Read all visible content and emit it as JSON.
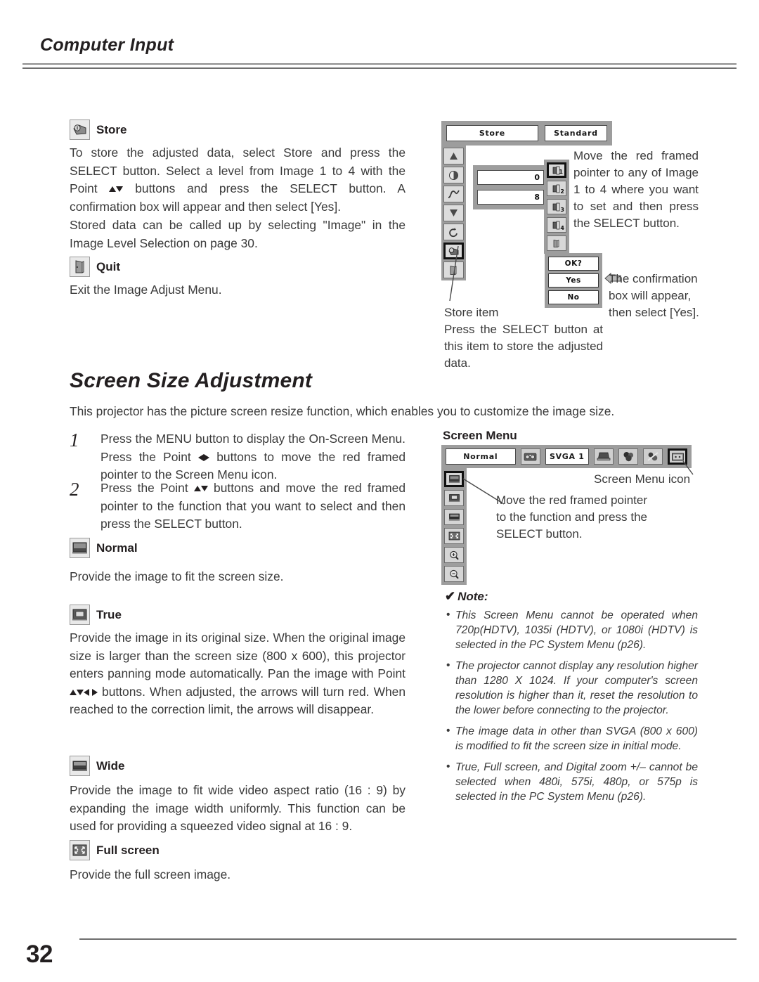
{
  "header": {
    "title": "Computer Input"
  },
  "sections": {
    "store": {
      "heading": "Store",
      "icon": "store-icon",
      "body_1": "To store the adjusted data, select Store and press the SELECT button.  Select a level from Image 1 to 4 with the Point ",
      "body_2": " buttons and press the SELECT button.  A confirmation box will appear and then select [Yes].",
      "body_3": "Stored data can be called up by selecting \"Image\" in the Image Level Selection on page 30."
    },
    "quit": {
      "heading": "Quit",
      "icon": "quit-door-icon",
      "body": "Exit the Image Adjust Menu."
    },
    "normal": {
      "heading": "Normal",
      "icon": "screen-normal-icon",
      "body": "Provide the image to fit the screen size."
    },
    "true": {
      "heading": "True",
      "icon": "screen-true-icon",
      "body_1": "Provide the image in its original size.  When the original image size is larger than the screen size (800 x 600), this projector enters panning mode automatically.  Pan the image with Point ",
      "body_2": " buttons.  When adjusted, the arrows will turn red.  When reached to the correction limit, the arrows will disappear."
    },
    "wide": {
      "heading": "Wide",
      "icon": "screen-wide-icon",
      "body": "Provide the image to fit wide video aspect ratio (16 : 9) by expanding the image width uniformly.  This function can be used for providing a squeezed video signal at 16 : 9."
    },
    "full_screen": {
      "heading": "Full screen",
      "icon": "screen-full-icon",
      "body": "Provide the full screen image."
    }
  },
  "screen_size_adjustment": {
    "title": "Screen Size Adjustment",
    "intro": "This projector has the picture screen resize function, which enables you to customize the image size.",
    "steps": [
      {
        "number": "1",
        "text_1": "Press the MENU button to display the On-Screen Menu.  Press the Point ",
        "text_2": " buttons to move the red framed pointer to the Screen Menu icon."
      },
      {
        "number": "2",
        "text_1": "Press the Point ",
        "text_2": " buttons and move the red framed pointer to the function that you want to select and then press the SELECT button."
      }
    ]
  },
  "image_adjust_osd": {
    "tabs": [
      {
        "label": "Store",
        "name": "store-tab"
      },
      {
        "label": "Standard",
        "name": "standard-tab"
      }
    ],
    "values": [
      {
        "value": "0",
        "name": "contrast-value"
      },
      {
        "value": "8",
        "name": "brightness-value"
      }
    ],
    "left_icons": [
      {
        "name": "contrast-icon"
      },
      {
        "name": "brightness-icon"
      },
      {
        "name": "gamma-icon"
      },
      {
        "name": "color-temp-icon"
      },
      {
        "name": "reset-icon"
      },
      {
        "name": "store-icon"
      },
      {
        "name": "quit-door-icon"
      }
    ],
    "image_levels": [
      {
        "label": "1",
        "name": "image-level-1"
      },
      {
        "label": "2",
        "name": "image-level-2"
      },
      {
        "label": "3",
        "name": "image-level-3"
      },
      {
        "label": "4",
        "name": "image-level-4"
      }
    ],
    "image_quit": {
      "name": "quit-door-icon"
    },
    "confirm_box": {
      "prompt": "OK?",
      "yes": "Yes",
      "no": "No"
    }
  },
  "callouts": {
    "move_pointer_image": "Move the red framed pointer to any of Image 1 to 4 where you want to set and then press the SELECT button.",
    "confirmation": "The confirmation box will appear, then select [Yes].",
    "store_item_title": "Store item",
    "store_item_body": "Press the SELECT button at this item to store the adjusted data.",
    "screen_menu_icon": "Screen Menu icon",
    "move_pointer_function": "Move the red framed pointer to the function and press the SELECT button."
  },
  "screen_menu": {
    "label": "Screen Menu",
    "current_mode": "Normal",
    "system": "SVGA 1",
    "top_icons": [
      {
        "name": "pc-system-icon"
      },
      {
        "name": "computer-input-icon"
      },
      {
        "name": "color-adjust-icon"
      },
      {
        "name": "image-adjust-icon"
      },
      {
        "name": "screen-menu-icon"
      }
    ],
    "left_items": [
      {
        "name": "screen-normal-icon"
      },
      {
        "name": "screen-true-icon"
      },
      {
        "name": "screen-wide-icon"
      },
      {
        "name": "screen-full-icon"
      },
      {
        "name": "digital-zoom-in-icon"
      },
      {
        "name": "digital-zoom-out-icon"
      }
    ]
  },
  "note": {
    "title": "Note:",
    "items": [
      "This Screen Menu cannot be operated when 720p(HDTV), 1035i (HDTV), or 1080i (HDTV) is selected in the PC System Menu  (p26).",
      "The projector cannot display any resolution higher than 1280 X 1024.  If your computer's screen resolution is higher than it, reset the resolution to the lower before connecting to the projector.",
      "The image data in other than SVGA (800 x 600) is modified to fit the screen size in initial mode.",
      "True, Full screen, and Digital zoom +/– cannot be selected when 480i, 575i, 480p, or 575p is selected in the PC System Menu  (p26)."
    ]
  },
  "footer": {
    "page_number": "32"
  }
}
